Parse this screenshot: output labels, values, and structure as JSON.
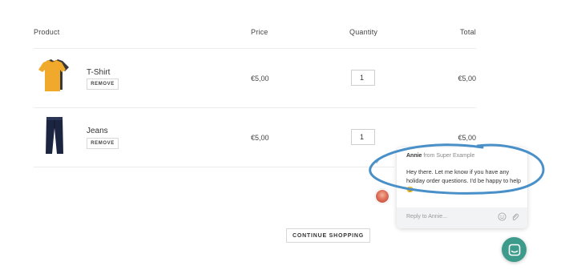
{
  "table": {
    "headers": {
      "product": "Product",
      "price": "Price",
      "quantity": "Quantity",
      "total": "Total"
    },
    "rows": [
      {
        "name": "T-Shirt",
        "remove_label": "REMOVE",
        "price": "€5,00",
        "quantity": "1",
        "total": "€5,00",
        "image_icon": "tshirt-image"
      },
      {
        "name": "Jeans",
        "remove_label": "REMOVE",
        "price": "€5,00",
        "quantity": "1",
        "total": "€5,00",
        "image_icon": "jeans-image"
      }
    ]
  },
  "continue_label": "CONTINUE SHOPPING",
  "chat": {
    "agent_name": "Annie",
    "from_text": "from Super Example",
    "message": "Hey there. Let me know if you have any holiday order questions. I'd be happy to help 😊",
    "reply_placeholder": "Reply to Annie...",
    "launcher_color": "#3d9b8b"
  },
  "annotation_color": "#4a90c8"
}
